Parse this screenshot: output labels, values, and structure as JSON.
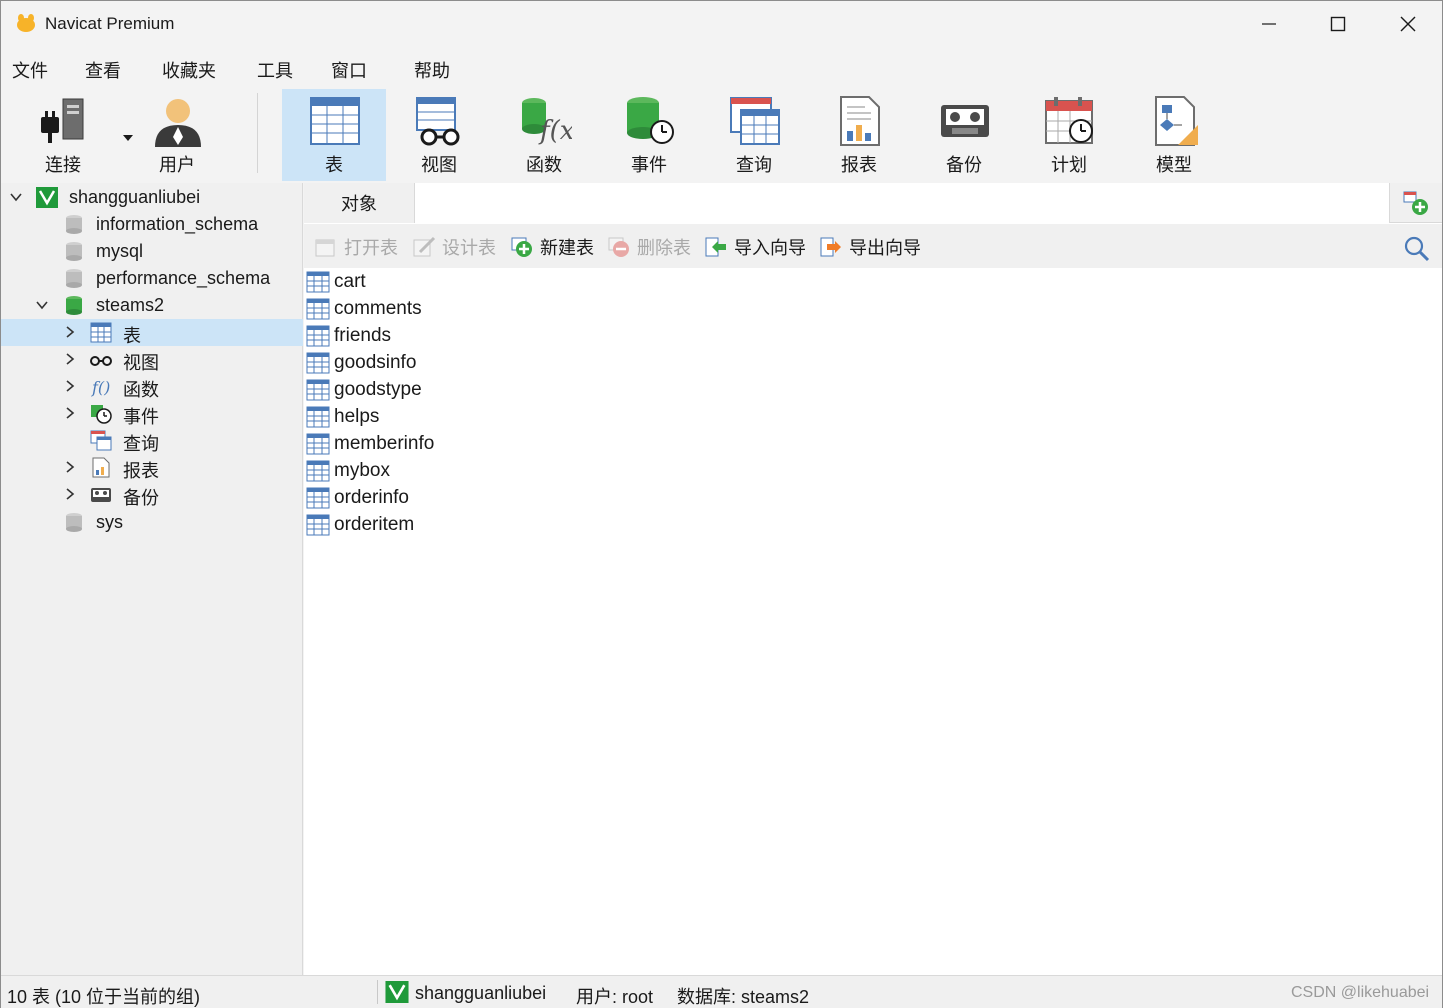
{
  "window": {
    "title": "Navicat Premium"
  },
  "menu": [
    "文件",
    "查看",
    "收藏夹",
    "工具",
    "窗口",
    "帮助"
  ],
  "toolbar": {
    "connect": "连接",
    "user": "用户",
    "table": "表",
    "view": "视图",
    "function": "函数",
    "event": "事件",
    "query": "查询",
    "report": "报表",
    "backup": "备份",
    "schedule": "计划",
    "model": "模型"
  },
  "tree": {
    "connection": "shangguanliubei",
    "databases": [
      "information_schema",
      "mysql",
      "performance_schema",
      "steams2",
      "sys"
    ],
    "steams2_children": [
      "表",
      "视图",
      "函数",
      "事件",
      "查询",
      "报表",
      "备份"
    ]
  },
  "objects": {
    "tab_label": "对象",
    "actions": {
      "open": "打开表",
      "design": "设计表",
      "new": "新建表",
      "delete": "删除表",
      "import": "导入向导",
      "export": "导出向导"
    },
    "tables": [
      "cart",
      "comments",
      "friends",
      "goodsinfo",
      "goodstype",
      "helps",
      "memberinfo",
      "mybox",
      "orderinfo",
      "orderitem"
    ]
  },
  "status": {
    "count": "10 表 (10 位于当前的组)",
    "connection": "shangguanliubei",
    "user": "用户: root",
    "database": "数据库: steams2",
    "watermark": "CSDN @likehuabei"
  },
  "colors": {
    "selected": "#cce4f7",
    "table_icon_blue": "#4a7ab8",
    "db_green": "#3aa845",
    "conn_green": "#1f9a3a"
  }
}
